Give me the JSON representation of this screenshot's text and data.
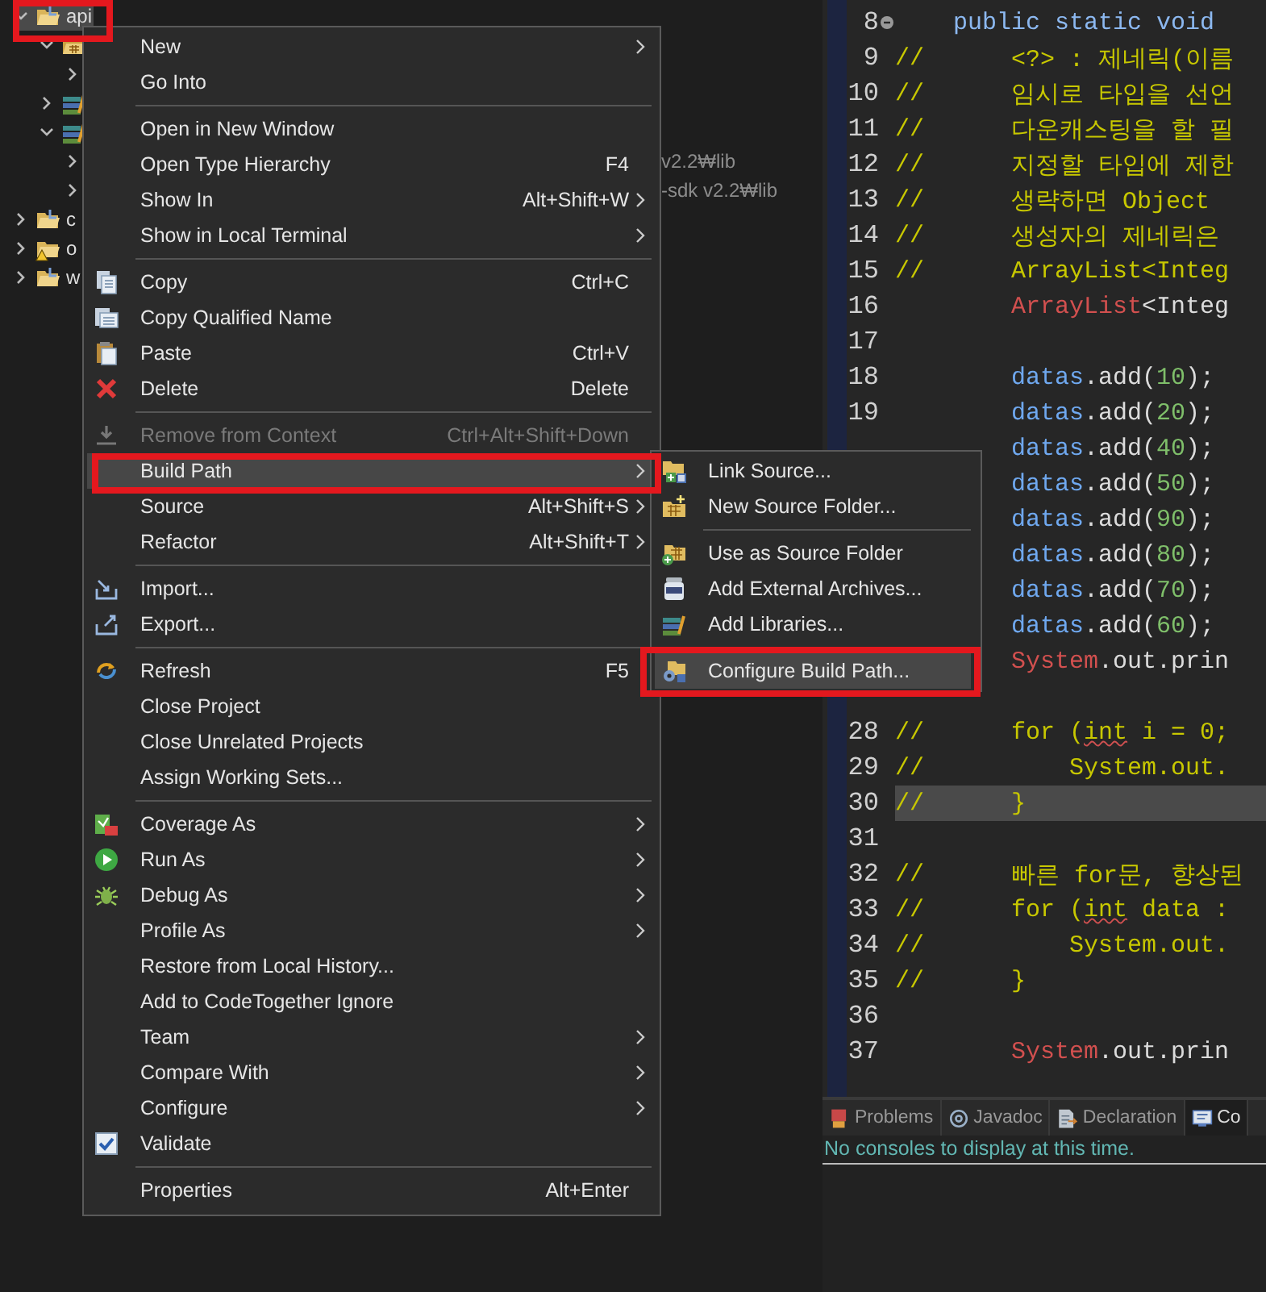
{
  "explorer": {
    "items": [
      {
        "label": "api",
        "kind": "project",
        "expanded": true,
        "selected": true,
        "children": [
          {
            "kind": "source-folder",
            "expanded": true,
            "selected": false,
            "children": [
              {
                "expanded": false,
                "selected": false
              }
            ]
          },
          {
            "kind": "library",
            "expanded": false,
            "selected": false
          },
          {
            "kind": "library",
            "expanded": true,
            "selected": false,
            "children": [
              {
                "expanded": false,
                "selected": false,
                "path": "v2.2₩lib"
              },
              {
                "expanded": false,
                "selected": false,
                "path": "-sdk v2.2₩lib"
              }
            ]
          }
        ]
      },
      {
        "label": "c",
        "kind": "project",
        "expanded": false,
        "selected": false
      },
      {
        "label": "o",
        "kind": "project-warning",
        "expanded": false,
        "selected": false
      },
      {
        "label": "w",
        "kind": "project",
        "expanded": false,
        "selected": false
      }
    ]
  },
  "editor": {
    "lines": [
      {
        "number": "8",
        "kind": "signature",
        "current": false,
        "tokens": [
          {
            "text": "public static void",
            "kind": "keyword"
          }
        ]
      },
      {
        "number": "9",
        "kind": "statement",
        "current": false,
        "tokens": [
          {
            "text": "//",
            "kind": "comment-marker"
          },
          {
            "text": "<?> : 제네릭(이름",
            "kind": "comment"
          }
        ]
      },
      {
        "number": "10",
        "kind": "statement",
        "current": false,
        "tokens": [
          {
            "text": "//",
            "kind": "comment-marker"
          },
          {
            "text": "임시로 타입을 선언",
            "kind": "comment"
          }
        ]
      },
      {
        "number": "11",
        "kind": "statement",
        "current": false,
        "tokens": [
          {
            "text": "//",
            "kind": "comment-marker"
          },
          {
            "text": "다운캐스팅을 할 필",
            "kind": "comment"
          }
        ]
      },
      {
        "number": "12",
        "kind": "statement",
        "current": false,
        "tokens": [
          {
            "text": "//",
            "kind": "comment-marker"
          },
          {
            "text": "지정할 타입에 제한",
            "kind": "comment"
          }
        ]
      },
      {
        "number": "13",
        "kind": "statement",
        "current": false,
        "tokens": [
          {
            "text": "//",
            "kind": "comment-marker"
          },
          {
            "text": "생략하면 Object",
            "kind": "comment"
          }
        ]
      },
      {
        "number": "14",
        "kind": "statement",
        "current": false,
        "tokens": [
          {
            "text": "//",
            "kind": "comment-marker"
          },
          {
            "text": "생성자의 제네릭은",
            "kind": "comment"
          }
        ]
      },
      {
        "number": "15",
        "kind": "statement",
        "current": false,
        "tokens": [
          {
            "text": "//",
            "kind": "comment-marker"
          },
          {
            "text": "ArrayList<Integ",
            "kind": "comment"
          }
        ]
      },
      {
        "number": "16",
        "kind": "statement",
        "current": false,
        "tokens": [
          {
            "text": "ArrayList",
            "kind": "type"
          },
          {
            "text": "<Integ",
            "kind": "plain"
          }
        ]
      },
      {
        "number": "17",
        "kind": "blank",
        "current": false
      },
      {
        "number": "18",
        "kind": "statement",
        "current": false,
        "tokens": [
          {
            "text": "datas",
            "kind": "field"
          },
          {
            "text": ".add(",
            "kind": "plain"
          },
          {
            "text": "10",
            "kind": "number"
          },
          {
            "text": ");",
            "kind": "plain"
          }
        ]
      },
      {
        "number": "19",
        "kind": "statement",
        "current": false,
        "tokens": [
          {
            "text": "datas",
            "kind": "field"
          },
          {
            "text": ".add(",
            "kind": "plain"
          },
          {
            "text": "20",
            "kind": "number"
          },
          {
            "text": ");",
            "kind": "plain"
          }
        ]
      },
      {
        "kind": "statement",
        "current": false,
        "tokens": [
          {
            "text": "datas",
            "kind": "field"
          },
          {
            "text": ".add(",
            "kind": "plain"
          },
          {
            "text": "40",
            "kind": "number"
          },
          {
            "text": ");",
            "kind": "plain"
          }
        ]
      },
      {
        "kind": "statement",
        "current": false,
        "tokens": [
          {
            "text": "datas",
            "kind": "field"
          },
          {
            "text": ".add(",
            "kind": "plain"
          },
          {
            "text": "50",
            "kind": "number"
          },
          {
            "text": ");",
            "kind": "plain"
          }
        ]
      },
      {
        "kind": "statement",
        "current": false,
        "tokens": [
          {
            "text": "datas",
            "kind": "field"
          },
          {
            "text": ".add(",
            "kind": "plain"
          },
          {
            "text": "90",
            "kind": "number"
          },
          {
            "text": ");",
            "kind": "plain"
          }
        ]
      },
      {
        "kind": "statement",
        "current": false,
        "tokens": [
          {
            "text": "datas",
            "kind": "field"
          },
          {
            "text": ".add(",
            "kind": "plain"
          },
          {
            "text": "80",
            "kind": "number"
          },
          {
            "text": ");",
            "kind": "plain"
          }
        ]
      },
      {
        "kind": "statement",
        "current": false,
        "tokens": [
          {
            "text": "datas",
            "kind": "field"
          },
          {
            "text": ".add(",
            "kind": "plain"
          },
          {
            "text": "70",
            "kind": "number"
          },
          {
            "text": ");",
            "kind": "plain"
          }
        ]
      },
      {
        "kind": "statement",
        "current": false,
        "tokens": [
          {
            "text": "datas",
            "kind": "field"
          },
          {
            "text": ".add(",
            "kind": "plain"
          },
          {
            "text": "60",
            "kind": "number"
          },
          {
            "text": ");",
            "kind": "plain"
          }
        ]
      },
      {
        "kind": "statement",
        "current": false,
        "tokens": [
          {
            "text": "System",
            "kind": "type"
          },
          {
            "text": ".out.prin",
            "kind": "plain"
          }
        ]
      },
      {
        "kind": "blank",
        "current": false
      },
      {
        "number": "28",
        "kind": "statement",
        "current": false,
        "tokens": [
          {
            "text": "//",
            "kind": "comment-marker"
          },
          {
            "text": "for (",
            "kind": "comment"
          },
          {
            "text": "int",
            "kind": "flagged"
          },
          {
            "text": " i = 0;",
            "kind": "comment"
          }
        ]
      },
      {
        "number": "29",
        "kind": "nested",
        "current": false,
        "tokens": [
          {
            "text": "//",
            "kind": "comment-marker"
          },
          {
            "text": "System.out.",
            "kind": "comment"
          }
        ]
      },
      {
        "number": "30",
        "kind": "statement",
        "current": true,
        "tokens": [
          {
            "text": "//",
            "kind": "comment-marker"
          },
          {
            "text": "}",
            "kind": "comment"
          }
        ]
      },
      {
        "number": "31",
        "kind": "blank",
        "current": false
      },
      {
        "number": "32",
        "kind": "statement",
        "current": false,
        "tokens": [
          {
            "text": "//",
            "kind": "comment-marker"
          },
          {
            "text": "빠른 for문, 향상된",
            "kind": "comment"
          }
        ]
      },
      {
        "number": "33",
        "kind": "statement",
        "current": false,
        "tokens": [
          {
            "text": "//",
            "kind": "comment-marker"
          },
          {
            "text": "for (",
            "kind": "comment"
          },
          {
            "text": "int",
            "kind": "flagged"
          },
          {
            "text": " data :",
            "kind": "comment"
          }
        ]
      },
      {
        "number": "34",
        "kind": "nested",
        "current": false,
        "tokens": [
          {
            "text": "//",
            "kind": "comment-marker"
          },
          {
            "text": "System.out.",
            "kind": "comment"
          }
        ]
      },
      {
        "number": "35",
        "kind": "statement",
        "current": false,
        "tokens": [
          {
            "text": "//",
            "kind": "comment-marker"
          },
          {
            "text": "}",
            "kind": "comment"
          }
        ]
      },
      {
        "number": "36",
        "kind": "blank",
        "current": false
      },
      {
        "number": "37",
        "kind": "statement",
        "current": false,
        "tokens": [
          {
            "text": "System",
            "kind": "type"
          },
          {
            "text": ".out.prin",
            "kind": "plain"
          }
        ]
      }
    ]
  },
  "panel": {
    "tabs": [
      {
        "label": "Problems",
        "kind": "problems",
        "selected": false
      },
      {
        "label": "Javadoc",
        "kind": "javadoc",
        "selected": false
      },
      {
        "label": "Declaration",
        "kind": "declaration",
        "selected": false
      },
      {
        "label": "Co",
        "kind": "console",
        "selected": true
      }
    ],
    "message": "No consoles to display at this time."
  },
  "context_menu": {
    "items": [
      {
        "label": "New",
        "kind": "plain",
        "submenu": true,
        "selected": false,
        "disabled": false
      },
      {
        "label": "Go Into",
        "kind": "plain",
        "submenu": false,
        "selected": false,
        "disabled": false
      },
      {
        "kind": "separator"
      },
      {
        "label": "Open in New Window",
        "kind": "plain",
        "submenu": false,
        "selected": false,
        "disabled": false
      },
      {
        "label": "Open Type Hierarchy",
        "kind": "plain",
        "shortcut": "F4",
        "submenu": false,
        "selected": false,
        "disabled": false
      },
      {
        "label": "Show In",
        "kind": "plain",
        "shortcut": "Alt+Shift+W",
        "submenu": true,
        "selected": false,
        "disabled": false
      },
      {
        "label": "Show in Local Terminal",
        "kind": "plain",
        "submenu": true,
        "selected": false,
        "disabled": false
      },
      {
        "kind": "separator"
      },
      {
        "label": "Copy",
        "kind": "copy",
        "shortcut": "Ctrl+C",
        "submenu": false,
        "selected": false,
        "disabled": false
      },
      {
        "label": "Copy Qualified Name",
        "kind": "copy-qualified",
        "submenu": false,
        "selected": false,
        "disabled": false
      },
      {
        "label": "Paste",
        "kind": "paste",
        "shortcut": "Ctrl+V",
        "submenu": false,
        "selected": false,
        "disabled": false
      },
      {
        "label": "Delete",
        "kind": "delete",
        "shortcut": "Delete",
        "submenu": false,
        "selected": false,
        "disabled": false
      },
      {
        "kind": "separator"
      },
      {
        "label": "Remove from Context",
        "kind": "remove",
        "shortcut": "Ctrl+Alt+Shift+Down",
        "submenu": false,
        "selected": false,
        "disabled": true
      },
      {
        "label": "Build Path",
        "kind": "plain",
        "submenu": true,
        "selected": true,
        "disabled": false
      },
      {
        "label": "Source",
        "kind": "plain",
        "shortcut": "Alt+Shift+S",
        "submenu": true,
        "selected": false,
        "disabled": false
      },
      {
        "label": "Refactor",
        "kind": "plain",
        "shortcut": "Alt+Shift+T",
        "submenu": true,
        "selected": false,
        "disabled": false
      },
      {
        "kind": "separator"
      },
      {
        "label": "Import...",
        "kind": "import",
        "submenu": false,
        "selected": false,
        "disabled": false
      },
      {
        "label": "Export...",
        "kind": "export",
        "submenu": false,
        "selected": false,
        "disabled": false
      },
      {
        "kind": "separator"
      },
      {
        "label": "Refresh",
        "kind": "refresh",
        "shortcut": "F5",
        "submenu": false,
        "selected": false,
        "disabled": false
      },
      {
        "label": "Close Project",
        "kind": "plain",
        "submenu": false,
        "selected": false,
        "disabled": false
      },
      {
        "label": "Close Unrelated Projects",
        "kind": "plain",
        "submenu": false,
        "selected": false,
        "disabled": false
      },
      {
        "label": "Assign Working Sets...",
        "kind": "plain",
        "submenu": false,
        "selected": false,
        "disabled": false
      },
      {
        "kind": "separator"
      },
      {
        "label": "Coverage As",
        "kind": "coverage",
        "submenu": true,
        "selected": false,
        "disabled": false
      },
      {
        "label": "Run As",
        "kind": "run",
        "submenu": true,
        "selected": false,
        "disabled": false
      },
      {
        "label": "Debug As",
        "kind": "debug",
        "submenu": true,
        "selected": false,
        "disabled": false
      },
      {
        "label": "Profile As",
        "kind": "plain",
        "submenu": true,
        "selected": false,
        "disabled": false
      },
      {
        "label": "Restore from Local History...",
        "kind": "plain",
        "submenu": false,
        "selected": false,
        "disabled": false
      },
      {
        "label": "Add to CodeTogether Ignore",
        "kind": "plain",
        "submenu": false,
        "selected": false,
        "disabled": false
      },
      {
        "label": "Team",
        "kind": "plain",
        "submenu": true,
        "selected": false,
        "disabled": false
      },
      {
        "label": "Compare With",
        "kind": "plain",
        "submenu": true,
        "selected": false,
        "disabled": false
      },
      {
        "label": "Configure",
        "kind": "plain",
        "submenu": true,
        "selected": false,
        "disabled": false
      },
      {
        "label": "Validate",
        "kind": "validate",
        "submenu": false,
        "selected": false,
        "disabled": false
      },
      {
        "kind": "separator"
      },
      {
        "label": "Properties",
        "kind": "plain",
        "shortcut": "Alt+Enter",
        "submenu": false,
        "selected": false,
        "disabled": false
      }
    ]
  },
  "submenu": {
    "items": [
      {
        "label": "Link Source...",
        "kind": "link-source",
        "selected": false,
        "disabled": false
      },
      {
        "label": "New Source Folder...",
        "kind": "new-source-folder",
        "selected": false,
        "disabled": false
      },
      {
        "kind": "separator"
      },
      {
        "label": "Use as Source Folder",
        "kind": "use-source",
        "selected": false,
        "disabled": false
      },
      {
        "label": "Add External Archives...",
        "kind": "archive",
        "selected": false,
        "disabled": false
      },
      {
        "label": "Add Libraries...",
        "kind": "libraries",
        "selected": false,
        "disabled": false
      },
      {
        "kind": "separator"
      },
      {
        "label": "Configure Build Path...",
        "kind": "configure",
        "selected": true,
        "disabled": false
      }
    ]
  },
  "highlights": [
    {
      "kind": "tree"
    },
    {
      "kind": "menu"
    },
    {
      "kind": "submenu"
    }
  ]
}
